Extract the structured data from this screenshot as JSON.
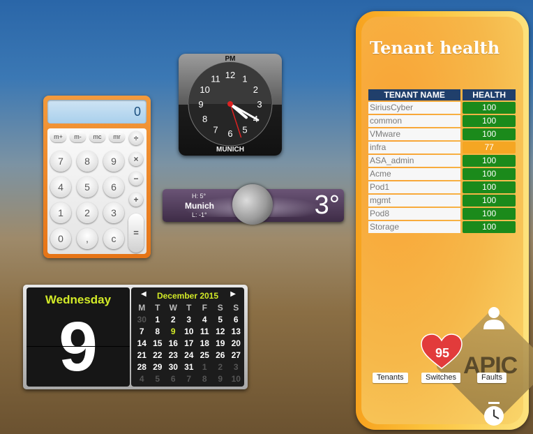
{
  "calculator": {
    "display": "0",
    "memory_keys": [
      "m+",
      "m-",
      "mc",
      "mr"
    ],
    "number_rows": [
      [
        "7",
        "8",
        "9"
      ],
      [
        "4",
        "5",
        "6"
      ],
      [
        "1",
        "2",
        "3"
      ],
      [
        "0",
        ",",
        "c"
      ]
    ],
    "op_keys": [
      "÷",
      "×",
      "−",
      "+"
    ],
    "equals": "="
  },
  "clock": {
    "ampm": "PM",
    "city": "MUNICH",
    "numbers": [
      "12",
      "1",
      "2",
      "3",
      "4",
      "5",
      "6",
      "7",
      "8",
      "9",
      "10",
      "11"
    ],
    "time": {
      "hour": 4,
      "minute": 20,
      "second": 27
    }
  },
  "weather": {
    "high": "H: 5°",
    "low": "L: -1°",
    "city": "Munich",
    "temp": "3°"
  },
  "calendar": {
    "weekday": "Wednesday",
    "day": "9",
    "month_title": "December 2015",
    "headers": [
      "M",
      "T",
      "W",
      "T",
      "F",
      "S",
      "S"
    ],
    "weeks": [
      [
        "30",
        "1",
        "2",
        "3",
        "4",
        "5",
        "6"
      ],
      [
        "7",
        "8",
        "9",
        "10",
        "11",
        "12",
        "13"
      ],
      [
        "14",
        "15",
        "16",
        "17",
        "18",
        "19",
        "20"
      ],
      [
        "21",
        "22",
        "23",
        "24",
        "25",
        "26",
        "27"
      ],
      [
        "28",
        "29",
        "30",
        "31",
        "1",
        "2",
        "3"
      ],
      [
        "4",
        "5",
        "6",
        "7",
        "8",
        "9",
        "10"
      ]
    ]
  },
  "tenant_health": {
    "title": "Tenant health",
    "headers": {
      "name": "TENANT NAME",
      "health": "HEALTH"
    },
    "rows": [
      {
        "name": "SiriusCyber",
        "health": "100",
        "status": "good"
      },
      {
        "name": "common",
        "health": "100",
        "status": "good"
      },
      {
        "name": "VMware",
        "health": "100",
        "status": "good"
      },
      {
        "name": "infra",
        "health": "77",
        "status": "warn"
      },
      {
        "name": "ASA_admin",
        "health": "100",
        "status": "good"
      },
      {
        "name": "Acme",
        "health": "100",
        "status": "good"
      },
      {
        "name": "Pod1",
        "health": "100",
        "status": "good"
      },
      {
        "name": "mgmt",
        "health": "100",
        "status": "good"
      },
      {
        "name": "Pod8",
        "health": "100",
        "status": "good"
      },
      {
        "name": "Storage",
        "health": "100",
        "status": "good"
      }
    ],
    "colors": {
      "good": "#1b8a1b",
      "warn": "#f5a623"
    },
    "overall_score": "95",
    "logo_text": "APIC",
    "buttons": {
      "tenants": "Tenants",
      "switches": "Switches",
      "faults": "Faults"
    }
  }
}
